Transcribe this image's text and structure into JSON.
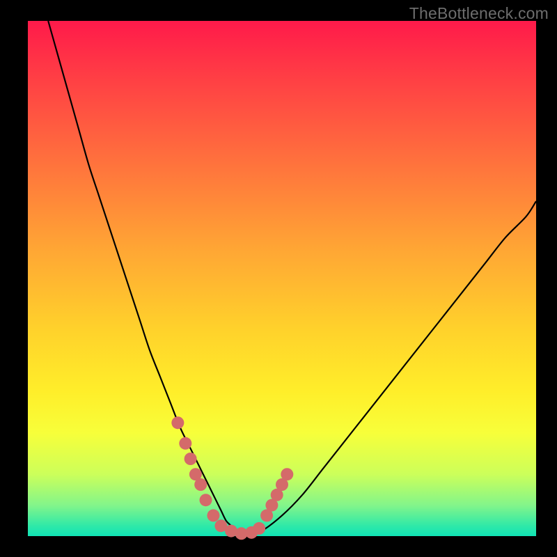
{
  "watermark": "TheBottleneck.com",
  "chart_data": {
    "type": "line",
    "title": "",
    "xlabel": "",
    "ylabel": "",
    "xlim": [
      0,
      100
    ],
    "ylim": [
      0,
      100
    ],
    "grid": false,
    "series": [
      {
        "name": "bottleneck-curve",
        "x": [
          4,
          6,
          8,
          10,
          12,
          14,
          16,
          18,
          20,
          22,
          24,
          26,
          28,
          30,
          32,
          34,
          36,
          37,
          38,
          39,
          40,
          41,
          42,
          44,
          46,
          50,
          54,
          58,
          62,
          66,
          70,
          74,
          78,
          82,
          86,
          90,
          94,
          98,
          100
        ],
        "values": [
          100,
          93,
          86,
          79,
          72,
          66,
          60,
          54,
          48,
          42,
          36,
          31,
          26,
          21,
          17,
          13,
          9,
          7,
          5,
          3,
          2,
          1,
          0.5,
          0.5,
          1,
          4,
          8,
          13,
          18,
          23,
          28,
          33,
          38,
          43,
          48,
          53,
          58,
          62,
          65
        ]
      }
    ],
    "markers": [
      {
        "name": "left-dot-1",
        "x": 29.5,
        "value": 22
      },
      {
        "name": "left-dot-2",
        "x": 31,
        "value": 18
      },
      {
        "name": "left-dot-3",
        "x": 32,
        "value": 15
      },
      {
        "name": "left-dot-4",
        "x": 33,
        "value": 12
      },
      {
        "name": "left-dot-5",
        "x": 34,
        "value": 10
      },
      {
        "name": "left-dot-6",
        "x": 35,
        "value": 7
      },
      {
        "name": "floor-1",
        "x": 36.5,
        "value": 4
      },
      {
        "name": "floor-2",
        "x": 38,
        "value": 2
      },
      {
        "name": "floor-3",
        "x": 40,
        "value": 1
      },
      {
        "name": "floor-4",
        "x": 42,
        "value": 0.5
      },
      {
        "name": "floor-5",
        "x": 44,
        "value": 0.7
      },
      {
        "name": "floor-6",
        "x": 45.5,
        "value": 1.5
      },
      {
        "name": "right-dot-1",
        "x": 47,
        "value": 4
      },
      {
        "name": "right-dot-2",
        "x": 48,
        "value": 6
      },
      {
        "name": "right-dot-3",
        "x": 49,
        "value": 8
      },
      {
        "name": "right-dot-4",
        "x": 50,
        "value": 10
      },
      {
        "name": "right-dot-5",
        "x": 51,
        "value": 12
      }
    ],
    "colors": {
      "curve": "#000000",
      "marker": "#d46a6a",
      "gradient_top": "#ff1a4a",
      "gradient_mid": "#ffd22b",
      "gradient_bottom": "#10e3b5",
      "frame": "#000000"
    }
  }
}
